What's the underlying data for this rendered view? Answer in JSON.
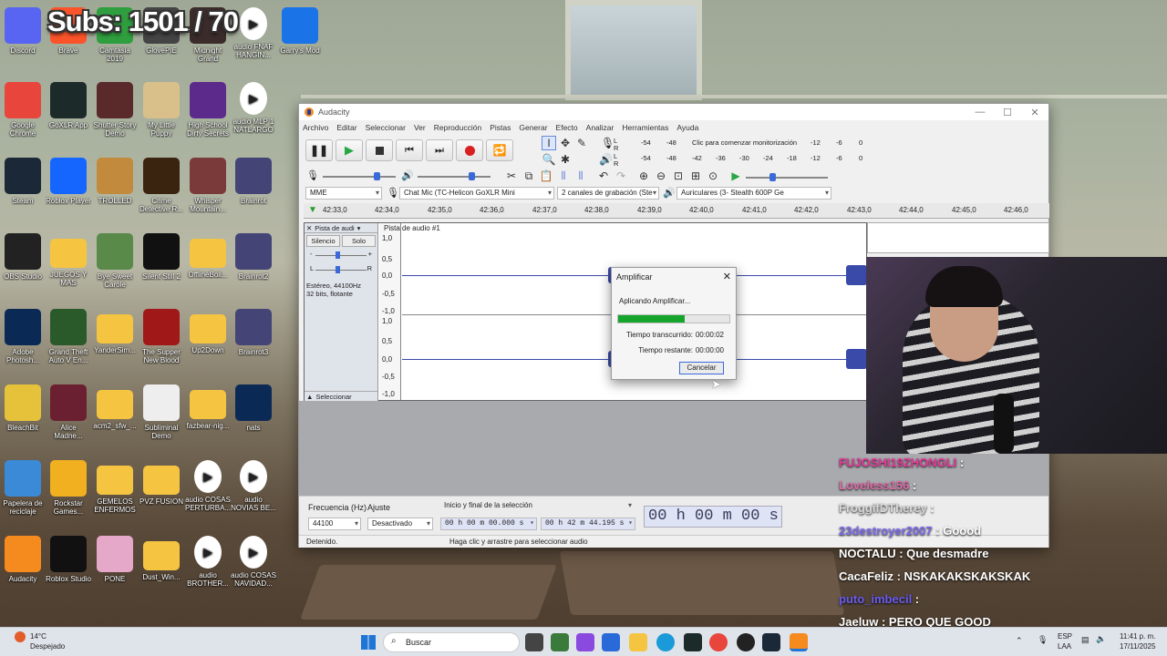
{
  "overlay": {
    "subs": "Subs: 1501 / 70"
  },
  "desktop_icons": [
    {
      "label": "Discord",
      "icon": "discord-icon",
      "color": "#5865f2"
    },
    {
      "label": "Brave",
      "icon": "brave-icon",
      "color": "#fb542b"
    },
    {
      "label": "Camtasia 2019",
      "icon": "camtasia-icon",
      "color": "#2f9e3e"
    },
    {
      "label": "GlovePIE",
      "icon": "glovepie-icon",
      "color": "#444"
    },
    {
      "label": "Midnight Grand",
      "icon": "game-icon",
      "color": "#3b2b2b"
    },
    {
      "label": "audio FNAF HANGIN...",
      "icon": "audio-file-icon",
      "color": "#fff"
    },
    {
      "label": "Garry's Mod",
      "icon": "gmod-icon",
      "color": "#1b73e8"
    },
    {
      "label": "Google Chrome",
      "icon": "chrome-icon",
      "color": "#e8453c"
    },
    {
      "label": "GoXLR App",
      "icon": "goxlr-icon",
      "color": "#1d2a2a"
    },
    {
      "label": "Shutter Story Demo",
      "icon": "game-icon",
      "color": "#5a2a2a"
    },
    {
      "label": "My Little Puppy",
      "icon": "game-icon",
      "color": "#d9c08a"
    },
    {
      "label": "High School Dirty Secrets",
      "icon": "game-icon",
      "color": "#5b2a8a"
    },
    {
      "label": "audio MLP 1 NATLARGO",
      "icon": "audio-file-icon",
      "color": "#fff"
    },
    {
      "label": "Steam",
      "icon": "steam-icon",
      "color": "#1b2838"
    },
    {
      "label": "Roblox Player",
      "icon": "roblox-icon",
      "color": "#1466ff"
    },
    {
      "label": "TROLLED",
      "icon": "game-icon",
      "color": "#c28a3c"
    },
    {
      "label": "Crime Detective R...",
      "icon": "game-icon",
      "color": "#3a2410"
    },
    {
      "label": "Whisper Mountain...",
      "icon": "game-icon",
      "color": "#7a3a3a"
    },
    {
      "label": "Brainrot",
      "icon": "brainrot-icon",
      "color": "#447"
    },
    {
      "label": "OBS Studio",
      "icon": "obs-icon",
      "color": "#222"
    },
    {
      "label": "JUEGOS Y MAS",
      "icon": "folder-icon",
      "color": "#f5c542"
    },
    {
      "label": "Bye Sweet Carole",
      "icon": "game-icon",
      "color": "#5a8a4a"
    },
    {
      "label": "Silent Still 2",
      "icon": "game-icon",
      "color": "#111"
    },
    {
      "label": "OfflineBoli...",
      "icon": "folder-icon",
      "color": "#f5c542"
    },
    {
      "label": "Brainrot2",
      "icon": "brainrot-icon",
      "color": "#447"
    },
    {
      "label": "Adobe Photosh...",
      "icon": "photoshop-icon",
      "color": "#0a2a55"
    },
    {
      "label": "Grand Theft Auto V En...",
      "icon": "gta-icon",
      "color": "#2a5a2a"
    },
    {
      "label": "YanderSim...",
      "icon": "folder-icon",
      "color": "#f5c542"
    },
    {
      "label": "The Supper New Blood",
      "icon": "game-icon",
      "color": "#a01818"
    },
    {
      "label": "Up2Down",
      "icon": "folder-icon",
      "color": "#f5c542"
    },
    {
      "label": "Brainrot3",
      "icon": "brainrot-icon",
      "color": "#447"
    },
    {
      "label": "BleachBit",
      "icon": "bleachbit-icon",
      "color": "#e6c23a"
    },
    {
      "label": "Alice Madne...",
      "icon": "game-icon",
      "color": "#6a2030"
    },
    {
      "label": "acm2_sfw_...",
      "icon": "folder-icon",
      "color": "#f5c542"
    },
    {
      "label": "Subliminal Demo",
      "icon": "game-icon",
      "color": "#eee"
    },
    {
      "label": "fazbear-nig...",
      "icon": "folder-icon",
      "color": "#f5c542"
    },
    {
      "label": "nats",
      "icon": "psd-file-icon",
      "color": "#0a2a55"
    },
    {
      "label": "Papelera de reciclaje",
      "icon": "recycle-bin-icon",
      "color": "#3a8ad8"
    },
    {
      "label": "Rockstar Games...",
      "icon": "rockstar-icon",
      "color": "#f0b020"
    },
    {
      "label": "GEMELOS ENFERMOS",
      "icon": "folder-icon",
      "color": "#f5c542"
    },
    {
      "label": "PVZ FUSION",
      "icon": "folder-icon",
      "color": "#f5c542"
    },
    {
      "label": "audio COSAS PERTURBA...",
      "icon": "audio-file-icon",
      "color": "#fff"
    },
    {
      "label": "audio NOVIAS BE...",
      "icon": "audio-file-icon",
      "color": "#fff"
    },
    {
      "label": "Audacity",
      "icon": "audacity-icon",
      "color": "#f58a1f"
    },
    {
      "label": "Roblox Studio",
      "icon": "roblox-studio-icon",
      "color": "#111"
    },
    {
      "label": "PONE",
      "icon": "game-icon",
      "color": "#e5a8c8"
    },
    {
      "label": "Dust_Win...",
      "icon": "folder-icon",
      "color": "#f5c542"
    },
    {
      "label": "audio BROTHER...",
      "icon": "audio-file-icon",
      "color": "#fff"
    },
    {
      "label": "audio COSAS NAVIDAD...",
      "icon": "audio-file-icon",
      "color": "#fff"
    }
  ],
  "audacity": {
    "title": "Audacity",
    "menu": [
      "Archivo",
      "Editar",
      "Seleccionar",
      "Ver",
      "Reproducción",
      "Pistas",
      "Generar",
      "Efecto",
      "Analizar",
      "Herramientas",
      "Ayuda"
    ],
    "meter_rec": {
      "L": "L",
      "R": "R",
      "ticks1": [
        "-54",
        "-48"
      ],
      "msg": "Clic para comenzar monitorización",
      "ticks2": [
        "-12",
        "-6",
        "0"
      ]
    },
    "meter_play": {
      "L": "L",
      "R": "R",
      "ticks": [
        "-54",
        "-48",
        "-42",
        "-36",
        "-30",
        "-24",
        "-18",
        "-12",
        "-6",
        "0"
      ]
    },
    "devices": {
      "host": "MME",
      "input": "Chat Mic (TC-Helicon GoXLR Mini",
      "channels": "2 canales de grabación (Ste",
      "output": "Auriculares (3- Stealth 600P Ge"
    },
    "ruler": [
      "42:33,0",
      "42:34,0",
      "42:35,0",
      "42:36,0",
      "42:37,0",
      "42:38,0",
      "42:39,0",
      "42:40,0",
      "42:41,0",
      "42:42,0",
      "42:43,0",
      "42:44,0",
      "42:45,0",
      "42:46,0"
    ],
    "track": {
      "name": "Pista de audi",
      "title": "Pista de audio #1",
      "mute": "Silencio",
      "solo": "Solo",
      "L": "L",
      "R": "R",
      "info1": "Estéreo, 44100Hz",
      "info2": "32 bits, flotante",
      "select": "Seleccionar",
      "scale": [
        "1,0",
        "0,5",
        "0,0",
        "-0,5",
        "-1,0"
      ]
    },
    "bottom": {
      "freq_label": "Frecuencia (Hz)",
      "freq_value": "44100",
      "snap_label": "Ajuste",
      "snap_value": "Desactivado",
      "selection_mode": "Inicio y final de la selección",
      "sel_start": "00 h 00 m 00.000 s",
      "sel_end": "00 h 42 m 44.195 s",
      "time": "00 h 00 m 00 s"
    },
    "status": {
      "left": "Detenido.",
      "right": "Haga clic y arrastre para seleccionar audio"
    }
  },
  "dialog": {
    "title": "Amplificar",
    "message": "Aplicando Amplificar...",
    "progress": 0.6,
    "elapsed_label": "Tiempo transcurrido:",
    "elapsed": "00:00:02",
    "remaining_label": "Tiempo restante:",
    "remaining": "00:00:00",
    "cancel": "Cancelar"
  },
  "chat": [
    {
      "user": "FUJOSHI19ZHONGLI",
      "msg": "",
      "color": "#e6399b"
    },
    {
      "user": "Loveless156",
      "msg": "",
      "color": "#e06aa8"
    },
    {
      "user": "FroggifDTherey",
      "msg": "",
      "color": "#d8d8d8"
    },
    {
      "user": "23destroyer2007",
      "msg": "Goood",
      "color": "#7a6cf0"
    },
    {
      "user": "NOCTALU",
      "msg": "Que desmadre",
      "color": "#ffffff"
    },
    {
      "user": "CacaFeliz",
      "msg": "NSKAKAKSKAKSKAK",
      "color": "#ffffff"
    },
    {
      "user": "puto_imbecil",
      "msg": "",
      "color": "#6a5cf0"
    },
    {
      "user": "Jaeluw",
      "msg": "PERO QUE GOOD",
      "color": "#ffffff"
    }
  ],
  "taskbar": {
    "temp": "14°C",
    "weather": "Despejado",
    "search": "Buscar",
    "lang1": "ESP",
    "lang2": "LAA",
    "time": "11:41 p. m.",
    "date": "17/11/2025"
  }
}
